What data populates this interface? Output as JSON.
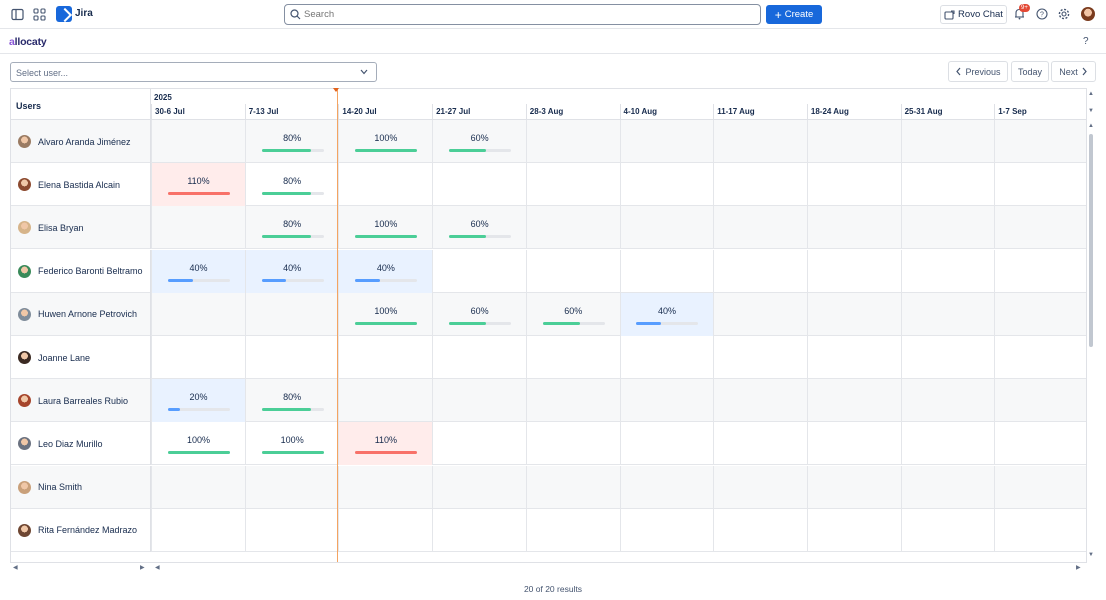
{
  "nav": {
    "app_name": "Jira",
    "search_placeholder": "Search",
    "create_label": "Create",
    "rovo_label": "Rovo Chat",
    "notification_badge": "9+",
    "icons": [
      "sidebar-toggle-icon",
      "app-switcher-icon",
      "jira-logo-icon",
      "search-icon",
      "bell-icon",
      "help-icon",
      "settings-icon"
    ]
  },
  "app": {
    "brand": "allocaty",
    "brand_initial": "a",
    "brand_rest": "llocaty",
    "help_label": "?"
  },
  "controls": {
    "select_user_placeholder": "Select user...",
    "previous_label": "Previous",
    "today_label": "Today",
    "next_label": "Next"
  },
  "grid": {
    "users_header": "Users",
    "year": "2025",
    "weeks": [
      "30-6 Jul",
      "7-13 Jul",
      "14-20 Jul",
      "21-27 Jul",
      "28-3 Aug",
      "4-10 Aug",
      "11-17 Aug",
      "18-24 Aug",
      "25-31 Aug",
      "1-7 Sep"
    ],
    "rows": [
      {
        "name": "Alvaro Aranda Jiménez",
        "avatar": "#9a7b63",
        "cells": [
          null,
          "80%",
          "100%",
          "60%",
          null,
          null,
          null,
          null,
          null,
          null
        ]
      },
      {
        "name": "Elena Bastida Alcain",
        "avatar": "#8c4a2f",
        "cells": [
          "110%",
          "80%",
          null,
          null,
          null,
          null,
          null,
          null,
          null,
          null
        ]
      },
      {
        "name": "Elisa Bryan",
        "avatar": "#d6b48a",
        "cells": [
          null,
          "80%",
          "100%",
          "60%",
          null,
          null,
          null,
          null,
          null,
          null
        ]
      },
      {
        "name": "Federico Baronti Beltramo",
        "avatar": "#3a8a5a",
        "cells": [
          "40%",
          "40%",
          "40%",
          null,
          null,
          null,
          null,
          null,
          null,
          null
        ]
      },
      {
        "name": "Huwen Arnone Petrovich",
        "avatar": "#7f8c9a",
        "cells": [
          null,
          null,
          "100%",
          "60%",
          "60%",
          "40%",
          null,
          null,
          null,
          null
        ]
      },
      {
        "name": "Joanne Lane",
        "avatar": "#3b2a22",
        "cells": [
          null,
          null,
          null,
          null,
          null,
          null,
          null,
          null,
          null,
          null
        ]
      },
      {
        "name": "Laura Barreales Rubio",
        "avatar": "#a6452c",
        "cells": [
          "20%",
          "80%",
          null,
          null,
          null,
          null,
          null,
          null,
          null,
          null
        ]
      },
      {
        "name": "Leo Diaz Murillo",
        "avatar": "#6b7280",
        "cells": [
          "100%",
          "100%",
          "110%",
          null,
          null,
          null,
          null,
          null,
          null,
          null
        ]
      },
      {
        "name": "Nina Smith",
        "avatar": "#c9a07a",
        "cells": [
          null,
          null,
          null,
          null,
          null,
          null,
          null,
          null,
          null,
          null
        ]
      },
      {
        "name": "Rita Fernández Madrazo",
        "avatar": "#6e4632",
        "cells": [
          null,
          null,
          null,
          null,
          null,
          null,
          null,
          null,
          null,
          null
        ]
      }
    ]
  },
  "colors": {
    "green": "#4bce97",
    "blue": "#579dff",
    "red": "#f87168",
    "blue_bg": "#e9f2ff",
    "red_bg": "#ffeceb",
    "track": "#e4e6ea"
  },
  "footer": {
    "results": "20 of 20 results"
  }
}
